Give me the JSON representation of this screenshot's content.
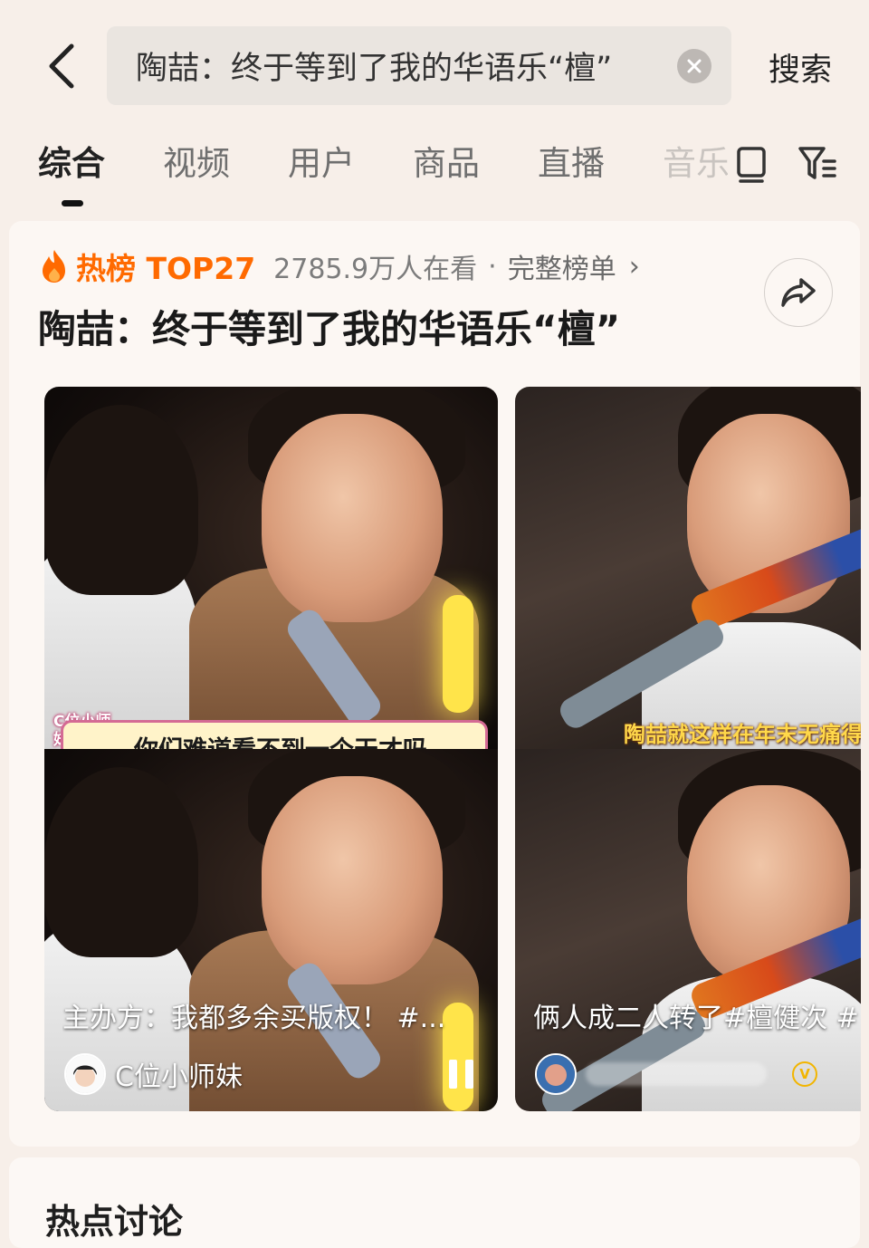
{
  "header": {
    "back_icon": "chevron-left-icon",
    "search_query": "陶喆：终于等到了我的华语乐“檀”",
    "clear_icon": "clear-icon",
    "search_button": "搜索"
  },
  "tabs": [
    {
      "label": "综合",
      "active": true
    },
    {
      "label": "视频",
      "active": false
    },
    {
      "label": "用户",
      "active": false
    },
    {
      "label": "商品",
      "active": false
    },
    {
      "label": "直播",
      "active": false
    },
    {
      "label": "音乐",
      "active": false
    }
  ],
  "tab_icons": [
    "layout-toggle-icon",
    "filter-icon"
  ],
  "hot_list": {
    "fire_icon": "fire-icon",
    "label": "热榜 TOP27",
    "viewers": "2785.9万人在看",
    "separator": "·",
    "full_list": "完整榜单",
    "chevron": "›",
    "share_icon": "share-icon",
    "title": "陶喆：终于等到了我的华语乐“檀”"
  },
  "videos": [
    {
      "subtitle_badge": "C位小师妹",
      "subtitle": "你们难道看不到一个天才吗",
      "title": "主办方：我都多余买版权！ #...",
      "author": "C位小师妹",
      "state_icon": "pause-icon"
    },
    {
      "caption": "陶喆就这样在年末无痛得到了一个关门大弟子",
      "title": "俩人成二人转了#檀健次 #",
      "author_badge": "V",
      "verified_icon": "verified-badge-icon"
    }
  ],
  "section": {
    "title": "热点讨论"
  },
  "colors": {
    "page_background": "#f7efe9",
    "hot_accent": "#ff6a00",
    "active_tab": "#222222",
    "inactive_tab": "#6f6f6f"
  }
}
